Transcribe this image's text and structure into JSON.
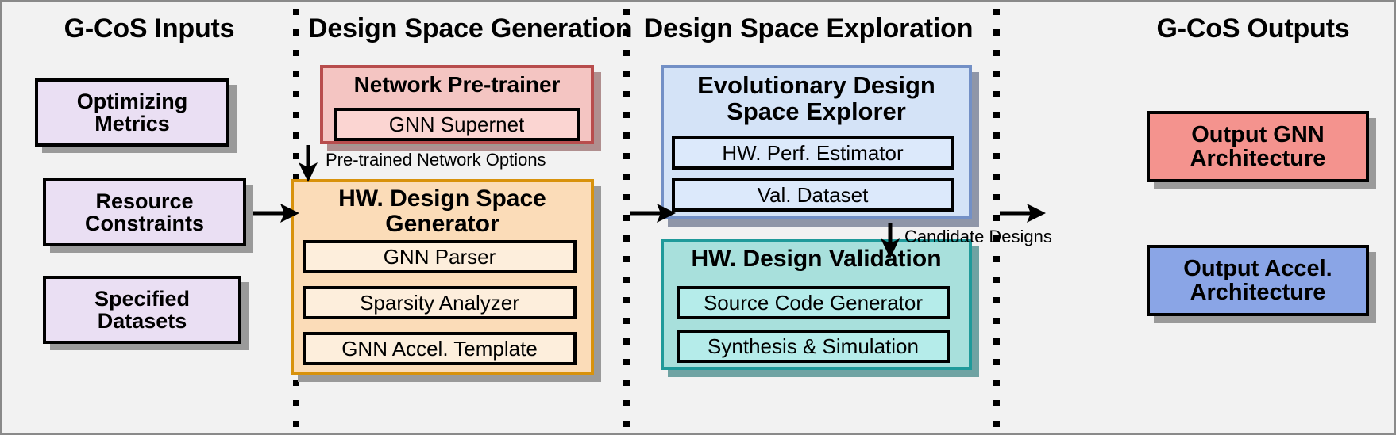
{
  "diagram": {
    "title": "G-CoS framework flow diagram",
    "columns": [
      {
        "id": "inputs",
        "title": "G-CoS Inputs"
      },
      {
        "id": "generation",
        "title": "Design Space Generation"
      },
      {
        "id": "exploration",
        "title": "Design Space Exploration"
      },
      {
        "id": "outputs",
        "title": "G-CoS Outputs"
      }
    ],
    "inputs": [
      {
        "label": "Optimizing\nMetrics",
        "line1": "Optimizing",
        "line2": "Metrics"
      },
      {
        "label": "Resource\nConstraints",
        "line1": "Resource",
        "line2": "Constraints"
      },
      {
        "label": "Specified\nDatasets",
        "line1": "Specified",
        "line2": "Datasets"
      }
    ],
    "generation": {
      "pretrainer": {
        "title": "Network Pre-trainer",
        "items": [
          "GNN Supernet"
        ]
      },
      "generator": {
        "title_line1": "HW. Design Space",
        "title_line2": "Generator",
        "items": [
          "GNN Parser",
          "Sparsity Analyzer",
          "GNN Accel. Template"
        ]
      }
    },
    "exploration": {
      "explorer": {
        "title_line1": "Evolutionary Design",
        "title_line2": "Space Explorer",
        "items": [
          "HW. Perf. Estimator",
          "Val. Dataset"
        ]
      },
      "validation": {
        "title": "HW. Design Validation",
        "items": [
          "Source Code Generator",
          "Synthesis & Simulation"
        ]
      }
    },
    "outputs": [
      {
        "line1": "Output GNN",
        "line2": "Architecture"
      },
      {
        "line1": "Output Accel.",
        "line2": "Architecture"
      }
    ],
    "edge_labels": {
      "pretrained_options": "Pre-trained Network Options",
      "candidate_designs": "Candidate Designs"
    },
    "colors": {
      "background": "#f2f2f2",
      "input_fill": "#eadff3",
      "pretrainer_fill": "#f4c5c2",
      "pretrainer_border": "#b84d4d",
      "generator_fill": "#fbdcb8",
      "generator_border": "#d8920c",
      "explorer_fill": "#d4e3f7",
      "explorer_border": "#7390c6",
      "validation_fill": "#a8e0dc",
      "validation_border": "#1f9a9a",
      "output_gnn_fill": "#f4938e",
      "output_accel_fill": "#8aa5e6",
      "border_black": "#000000",
      "shadow": "#9a9a9a"
    }
  }
}
